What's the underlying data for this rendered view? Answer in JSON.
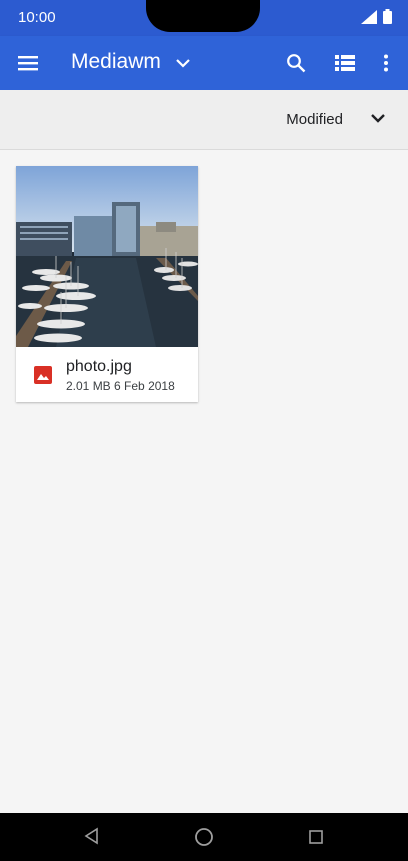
{
  "status_bar": {
    "time": "10:00"
  },
  "app_bar": {
    "title": "Mediawm",
    "menu_icon": "menu-icon",
    "dropdown_icon": "chevron-down-icon",
    "search_icon": "search-icon",
    "view_icon": "list-view-icon",
    "more_icon": "more-vert-icon",
    "color": "#2f63d8"
  },
  "sort_bar": {
    "label": "Modified",
    "icon": "chevron-down-icon"
  },
  "files": [
    {
      "name": "photo.jpg",
      "size": "2.01 MB",
      "date": "6 Feb 2018",
      "icon": "image-icon",
      "icon_color": "#d93025"
    }
  ],
  "nav_bar": {
    "back_icon": "back-icon",
    "home_icon": "home-icon",
    "recents_icon": "recents-icon"
  }
}
